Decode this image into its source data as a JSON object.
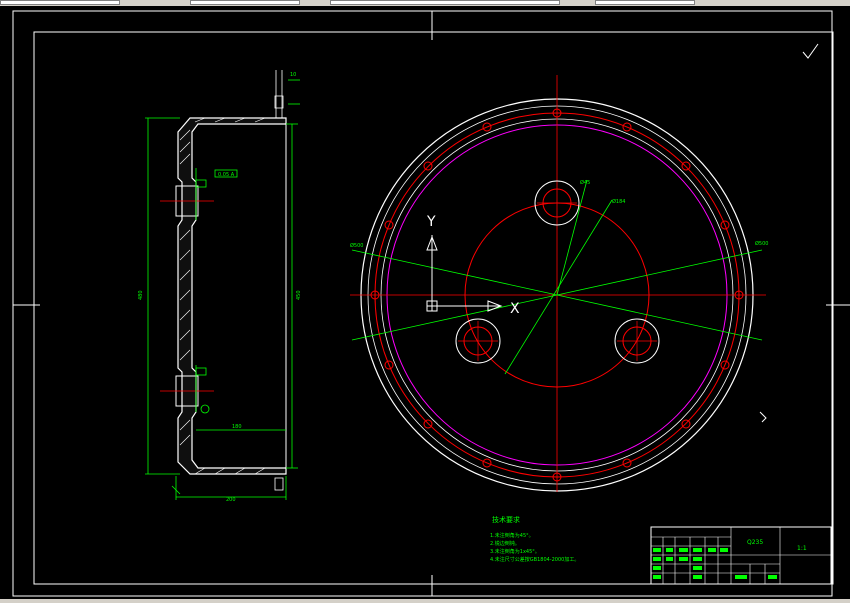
{
  "app": {
    "toolbar_fields": [
      "",
      "",
      "",
      ""
    ]
  },
  "ucs": {
    "y_label": "Y",
    "x_label": "X"
  },
  "notes": {
    "title": "技术要求",
    "items": [
      "1.未注倒角为45°。",
      "2.锐边倒钝。",
      "3.未注倒角为1x45°。",
      "4.未注尺寸公差按GB1804-2000加工。"
    ]
  },
  "title_block": {
    "material": "Q235",
    "scale": "1:1"
  },
  "colors": {
    "background": "#000000",
    "green": "#00ff00",
    "red": "#ff0000",
    "white": "#ffffff",
    "magenta": "#ff00ff"
  },
  "icons": {
    "ucs": "ucs-icon",
    "roughness": "roughness-symbol-icon",
    "crosshair": "crosshair-icon"
  }
}
